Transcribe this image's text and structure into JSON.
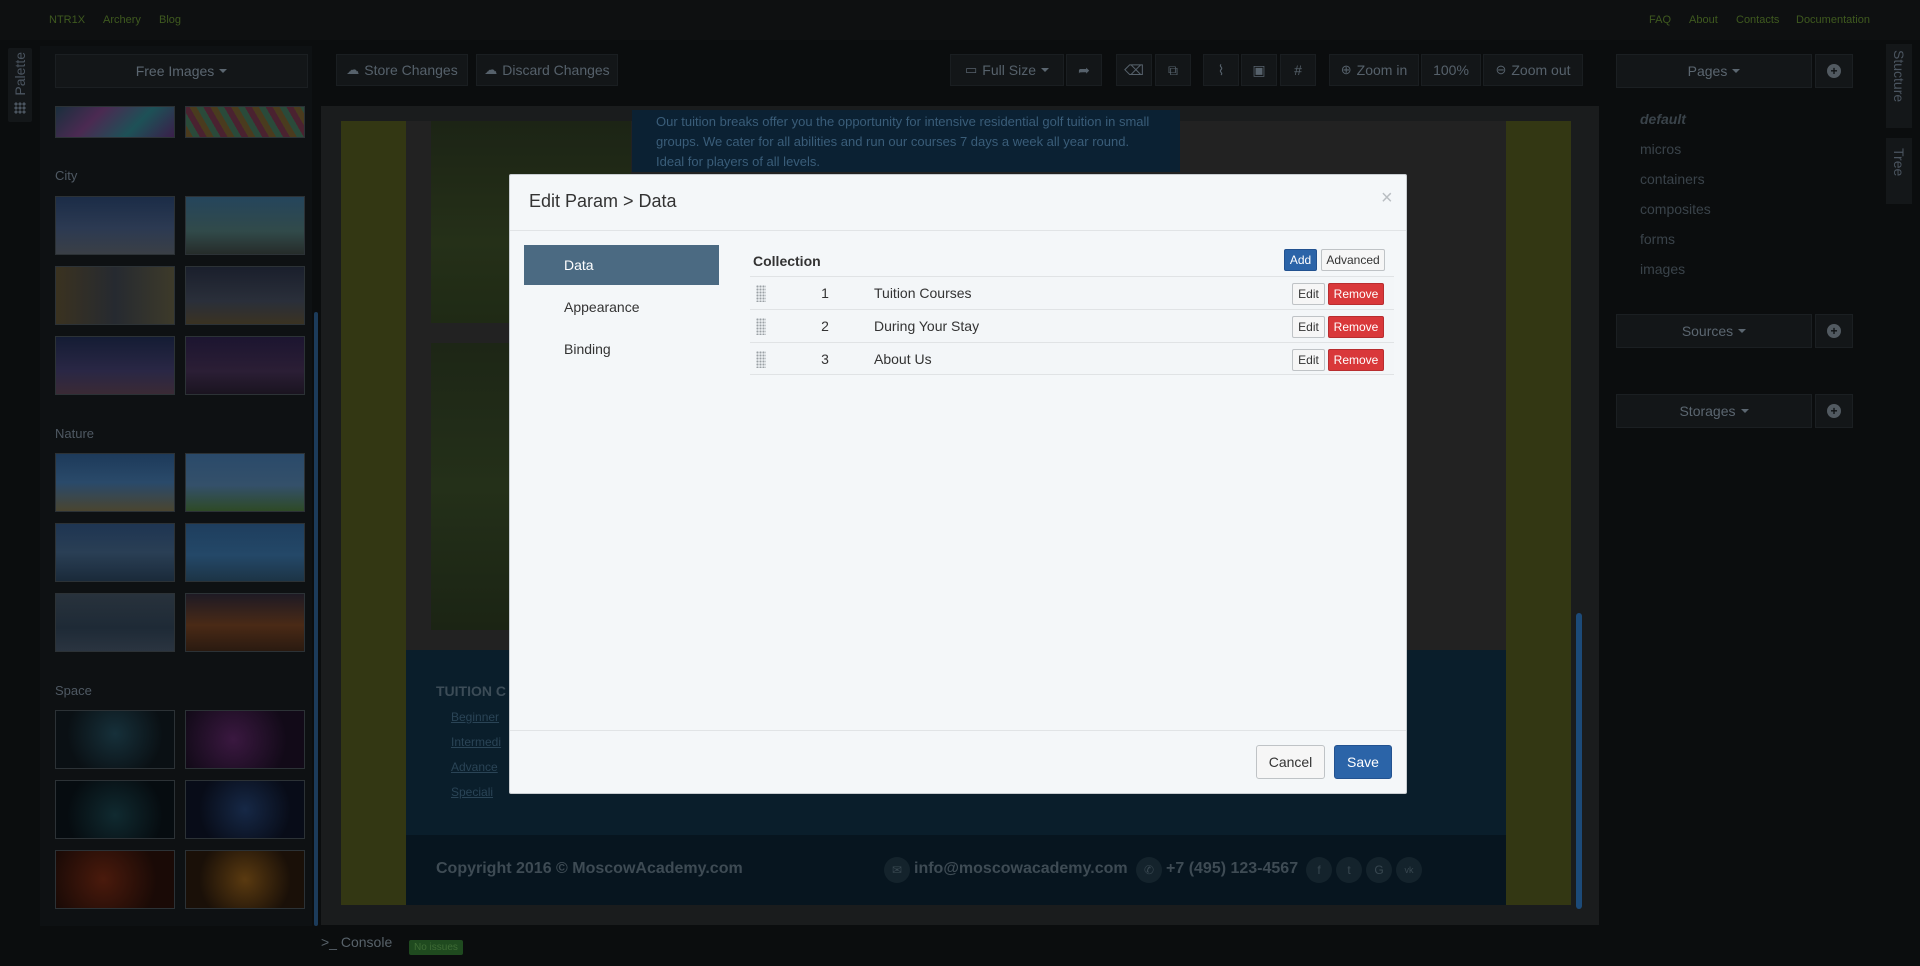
{
  "topbar": {
    "left_links": [
      "NTR1X",
      "Archery",
      "Blog"
    ],
    "right_links": [
      "FAQ",
      "About",
      "Contacts",
      "Documentation"
    ]
  },
  "palette_tab": {
    "label": "Palette"
  },
  "structure_tab": {
    "label": "Stucture"
  },
  "tree_tab": {
    "label": "Tree"
  },
  "left_panel": {
    "dropdown": "Free Images",
    "categories": [
      "City",
      "Nature",
      "Space"
    ]
  },
  "toolbar": {
    "store": "Store Changes",
    "discard": "Discard Changes",
    "full_size": "Full Size",
    "zoom_in": "Zoom in",
    "zoom_level": "100%",
    "zoom_out": "Zoom out"
  },
  "right_panel": {
    "pages_label": "Pages",
    "pages": [
      "default",
      "micros",
      "containers",
      "composites",
      "forms",
      "images"
    ],
    "sources_label": "Sources",
    "storages_label": "Storages"
  },
  "canvas": {
    "tuition_text": "Our tuition breaks offer you the opportunity for intensive residential golf tuition in small groups. We cater for all abilities and run our courses 7 days a week all year round. Ideal for players of all levels.",
    "footer_heading": "TUITION C",
    "footer_links": [
      "Beginner",
      "Intermedi",
      "Advance",
      "Speciali"
    ],
    "copyright": "Copyright 2016 © MoscowAcademy.com",
    "email": "info@moscowacademy.com",
    "phone": "+7 (495) 123-4567",
    "social": [
      "f",
      "t",
      "G",
      "vk"
    ]
  },
  "console": {
    "label": "Console",
    "status": "No issues"
  },
  "modal": {
    "title": "Edit Param > Data",
    "close": "×",
    "nav": [
      "Data",
      "Appearance",
      "Binding"
    ],
    "collection_label": "Collection",
    "add": "Add",
    "advanced": "Advanced",
    "rows": [
      {
        "num": "1",
        "title": "Tuition Courses"
      },
      {
        "num": "2",
        "title": "During Your Stay"
      },
      {
        "num": "3",
        "title": "About Us"
      }
    ],
    "edit": "Edit",
    "remove": "Remove",
    "cancel": "Cancel",
    "save": "Save"
  },
  "colors": {
    "accent": "#2b64a8",
    "danger": "#d9383a",
    "nav_active": "#4b6a82",
    "olive": "#333713"
  }
}
